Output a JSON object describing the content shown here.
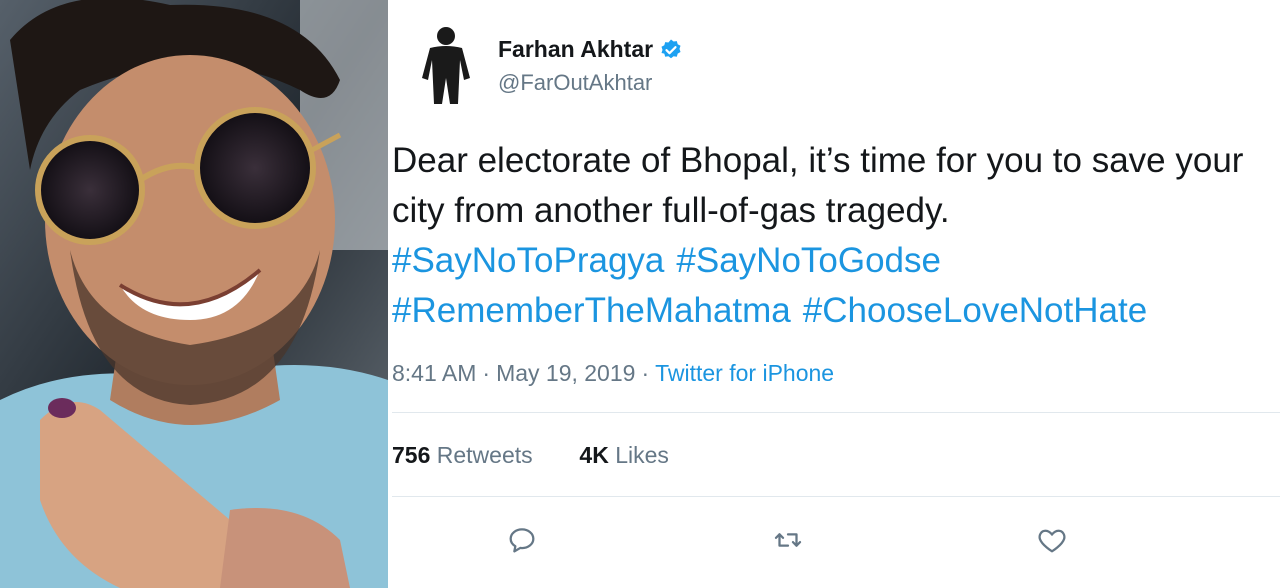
{
  "photo": {
    "description_icon": "person-photo"
  },
  "tweet": {
    "author_name": "Farhan Akhtar",
    "author_handle": "@FarOutAkhtar",
    "verified_icon": "verified-badge-icon",
    "text_lines": [
      "Dear electorate of Bhopal, it’s time for you to save your",
      "city from another full-of-gas tragedy."
    ],
    "hashtags_line1": [
      "#SayNoToPragya",
      "#SayNoToGodse"
    ],
    "hashtags_line2": [
      "#RememberTheMahatma",
      "#ChooseLoveNotHate"
    ],
    "time": "8:41 AM",
    "date": "May 19, 2019",
    "source": "Twitter for iPhone",
    "retweets_count": "756",
    "retweets_label": "Retweets",
    "likes_count": "4K",
    "likes_label": "Likes"
  },
  "actions": {
    "reply_icon": "reply-icon",
    "retweet_icon": "retweet-icon",
    "like_icon": "heart-icon"
  },
  "colors": {
    "link": "#1b95e0",
    "text": "#14171a",
    "muted": "#657786",
    "divider": "#e1e8ed"
  }
}
